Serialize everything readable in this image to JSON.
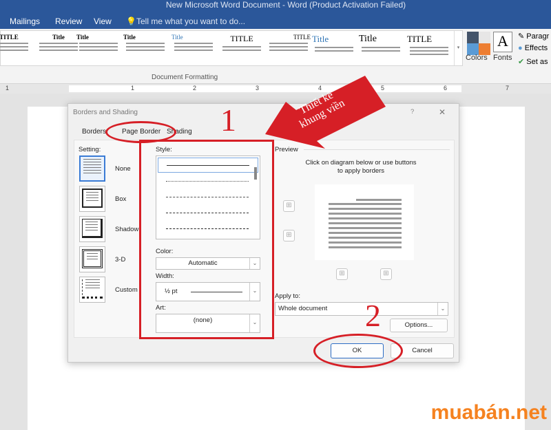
{
  "titlebar": {
    "title": "New Microsoft Word Document - Word (Product Activation Failed)"
  },
  "menu": {
    "items": [
      "Mailings",
      "Review",
      "View"
    ],
    "tell_me": "Tell me what you want to do..."
  },
  "ribbon": {
    "gallery": [
      "TITLE",
      "Title",
      "Title",
      "Title",
      "Title",
      "TITLE",
      "TITLE",
      "Title",
      "Title",
      "TITLE"
    ],
    "colors_label": "Colors",
    "fonts_label": "Fonts",
    "fonts_glyph": "A",
    "paragraph_label": "Paragr",
    "effects_label": "Effects",
    "set_as_label": "Set as",
    "group_label": "Document Formatting"
  },
  "ruler": {
    "ticks": [
      "1",
      "1",
      "2",
      "3",
      "4",
      "5",
      "6",
      "7"
    ]
  },
  "dialog": {
    "title": "Borders and Shading",
    "help": "?",
    "close": "✕",
    "tabs": [
      "Borders",
      "Page Border",
      "Shading"
    ],
    "active_tab": "Page Border",
    "setting": {
      "label": "Setting:",
      "options": [
        "None",
        "Box",
        "Shadow",
        "3-D",
        "Custom"
      ],
      "selected": "None"
    },
    "style": {
      "label": "Style:"
    },
    "color": {
      "label": "Color:",
      "value": "Automatic"
    },
    "width": {
      "label": "Width:",
      "value": "½ pt"
    },
    "art": {
      "label": "Art:",
      "value": "(none)"
    },
    "preview": {
      "label": "Preview",
      "hint": "Click on diagram below or use buttons to apply borders"
    },
    "apply_to": {
      "label": "Apply to:",
      "value": "Whole document"
    },
    "options_button": "Options...",
    "ok_button": "OK",
    "cancel_button": "Cancel"
  },
  "annotations": {
    "step1": "1",
    "step2": "2",
    "arrow_text_line1": "Thiết kế",
    "arrow_text_line2": "khung viền",
    "color": "#d61f26"
  },
  "watermark": "muabán.net"
}
